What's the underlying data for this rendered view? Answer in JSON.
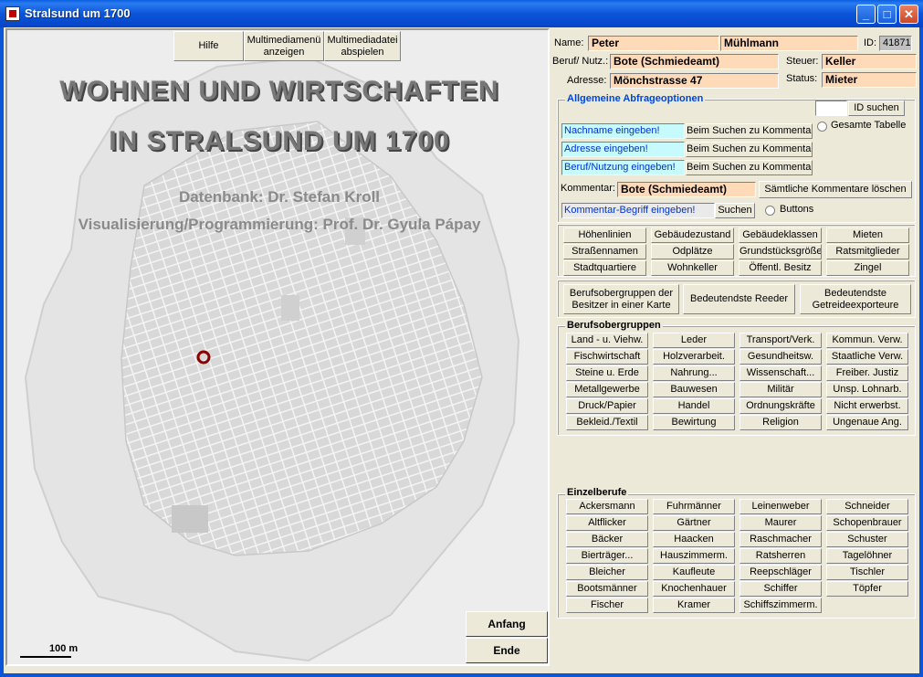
{
  "window": {
    "title": "Stralsund um 1700",
    "controls": [
      "_",
      "□",
      "✕"
    ]
  },
  "map_panel": {
    "top_buttons": [
      "Hilfe",
      "Multimediamenü anzeigen",
      "Multimediadatei abspielen"
    ],
    "heading_line1": "WOHNEN UND WIRTSCHAFTEN",
    "heading_line2": "IN STRALSUND UM 1700",
    "credit_db": "Datenbank: Dr. Stefan Kroll",
    "credit_vis": "Visualisierung/Programmierung: Prof. Dr. Gyula Pápay",
    "scale_label": "100 m",
    "nav_buttons": [
      "Anfang",
      "Ende"
    ],
    "marker_color": "#8B0000"
  },
  "record": {
    "name_label": "Name:",
    "first_name": "Peter",
    "last_name": "Mühlmann",
    "id_label": "ID:",
    "id_value": "41871",
    "beruf_label": "Beruf/ Nutz.:",
    "beruf_value": "Bote (Schmiedeamt)",
    "steuer_label": "Steuer:",
    "steuer_value": "Keller",
    "adresse_label": "Adresse:",
    "adresse_value": "Mönchstrasse 47",
    "status_label": "Status:",
    "status_value": "Mieter"
  },
  "query": {
    "title": "Allgemeine Abfrageoptionen",
    "id_search": "ID suchen",
    "radio_table": "Gesamte Tabelle",
    "nachname_placeholder": "Nachname eingeben!",
    "adresse_placeholder": "Adresse eingeben!",
    "beruf_placeholder": "Beruf/Nutzung eingeben!",
    "search_comment_btn": "Beim Suchen zu Kommentar",
    "kommentar_label": "Kommentar:",
    "kommentar_value": "Bote (Schmiedeamt)",
    "clear_comments": "Sämtliche Kommentare löschen",
    "kommentar_begriff_placeholder": "Kommentar-Begriff eingeben!",
    "suchen": "Suchen",
    "radio_buttons": "Buttons"
  },
  "categories": [
    "Höhenlinien",
    "Gebäudezustand",
    "Gebäudeklassen",
    "Mieten",
    "Straßennamen",
    "Odplätze",
    "Grundstücksgröße",
    "Ratsmitglieder",
    "Stadtquartiere",
    "Wohnkeller",
    "Öffentl. Besitz",
    "Zingel"
  ],
  "special": [
    "Berufsobergruppen der Besitzer in einer Karte",
    "Bedeutendste Reeder",
    "Bedeutendste Getreideexporteure"
  ],
  "berufsobergruppen": {
    "title": "Berufsobergruppen",
    "items": [
      "Land - u. Viehw.",
      "Leder",
      "Transport/Verk.",
      "Kommun. Verw.",
      "Fischwirtschaft",
      "Holzverarbeit.",
      "Gesundheitsw.",
      "Staatliche Verw.",
      "Steine u. Erde",
      "Nahrung...",
      "Wissenschaft...",
      "Freiber. Justiz",
      "Metallgewerbe",
      "Bauwesen",
      "Militär",
      "Unsp. Lohnarb.",
      "Druck/Papier",
      "Handel",
      "Ordnungskräfte",
      "Nicht erwerbst.",
      "Bekleid./Textil",
      "Bewirtung",
      "Religion",
      "Ungenaue Ang."
    ]
  },
  "einzelberufe": {
    "title": "Einzelberufe",
    "items": [
      "Ackersmann",
      "Fuhrmänner",
      "Leinenweber",
      "Schneider",
      "Altflicker",
      "Gärtner",
      "Maurer",
      "Schopenbrauer",
      "Bäcker",
      "Haacken",
      "Raschmacher",
      "Schuster",
      "Bierträger...",
      "Hauszimmerm.",
      "Ratsherren",
      "Tagelöhner",
      "Bleicher",
      "Kaufleute",
      "Reepschläger",
      "Tischler",
      "Bootsmänner",
      "Knochenhauer",
      "Schiffer",
      "Töpfer",
      "Fischer",
      "Kramer",
      "Schiffszimmerm."
    ]
  }
}
